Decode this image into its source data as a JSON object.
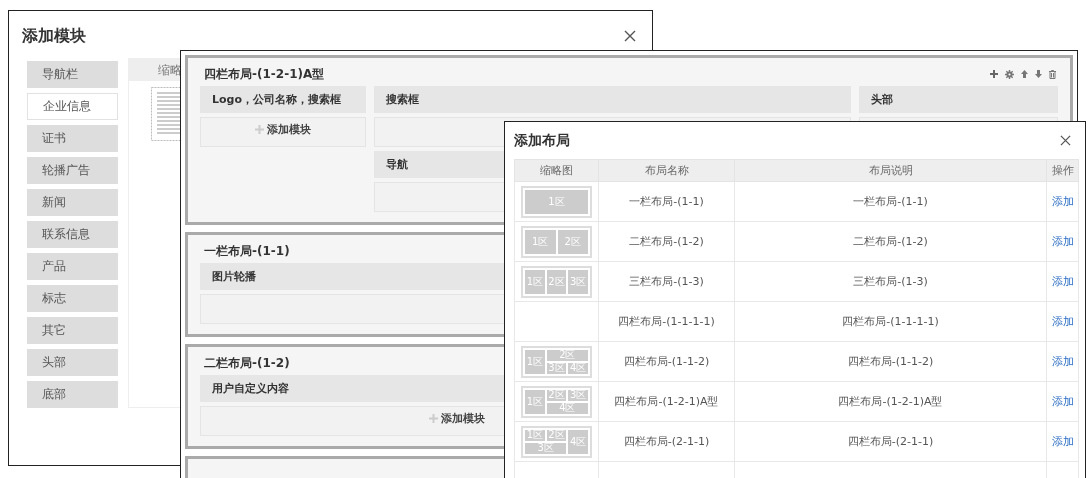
{
  "module_dialog": {
    "title": "添加模块",
    "sidebar": {
      "items": [
        {
          "label": "导航栏",
          "selected": false
        },
        {
          "label": "企业信息",
          "selected": true
        },
        {
          "label": "证书",
          "selected": false
        },
        {
          "label": "轮播广告",
          "selected": false
        },
        {
          "label": "新闻",
          "selected": false
        },
        {
          "label": "联系信息",
          "selected": false
        },
        {
          "label": "产品",
          "selected": false
        },
        {
          "label": "标志",
          "selected": false
        },
        {
          "label": "其它",
          "selected": false
        },
        {
          "label": "头部",
          "selected": false
        },
        {
          "label": "底部",
          "selected": false
        }
      ]
    },
    "preview_header": "缩略"
  },
  "layout_editor": {
    "sections": [
      {
        "title": "四栏布局-(1-2-1)A型",
        "kind": "three-column",
        "columns": [
          [
            {
              "label": "Logo，公司名称，搜索框",
              "add_label": "添加模块"
            }
          ],
          [
            {
              "label": "搜索框"
            },
            {
              "label": "导航"
            }
          ],
          [
            {
              "label": "头部"
            }
          ]
        ]
      },
      {
        "title": "一栏布局-(1-1)",
        "kind": "one-column",
        "columns": [
          [
            {
              "label": "图片轮播"
            }
          ]
        ]
      },
      {
        "title": "二栏布局-(1-2)",
        "kind": "one-column",
        "columns": [
          [
            {
              "label": "用户自定义内容",
              "add_label": "添加模块"
            }
          ]
        ]
      }
    ]
  },
  "layout_dialog": {
    "title": "添加布局",
    "columns": [
      "缩略图",
      "布局名称",
      "布局说明",
      "操作"
    ],
    "rows": [
      {
        "thumbnail": {
          "kind": "single",
          "zones": [
            "1区"
          ]
        },
        "name": "一栏布局-(1-1)",
        "description": "一栏布局-(1-1)",
        "action": "添加"
      },
      {
        "thumbnail": {
          "kind": "halves",
          "zones": [
            "1区",
            "2区"
          ]
        },
        "name": "二栏布局-(1-2)",
        "description": "二栏布局-(1-2)",
        "action": "添加"
      },
      {
        "thumbnail": {
          "kind": "thirds",
          "zones": [
            "1区",
            "2区",
            "3区"
          ]
        },
        "name": "三栏布局-(1-3)",
        "description": "三栏布局-(1-3)",
        "action": "添加"
      },
      {
        "name": "四栏布局-(1-1-1-1)",
        "description": "四栏布局-(1-1-1-1)",
        "action": "添加"
      },
      {
        "thumbnail": {
          "kind": "rightsplit",
          "zones": [
            "1区",
            "2区",
            "3区",
            "4区"
          ]
        },
        "name": "四栏布局-(1-1-2)",
        "description": "四栏布局-(1-1-2)",
        "action": "添加"
      },
      {
        "thumbnail": {
          "kind": "middlesplit",
          "zones": [
            "1区",
            "2区",
            "3区",
            "4区"
          ]
        },
        "name": "四栏布局-(1-2-1)A型",
        "description": "四栏布局-(1-2-1)A型",
        "action": "添加"
      },
      {
        "thumbnail": {
          "kind": "leftgrid",
          "zones": [
            "1区",
            "2区",
            "3区",
            "4区"
          ]
        },
        "name": "四栏布局-(2-1-1)",
        "description": "四栏布局-(2-1-1)",
        "action": "添加"
      }
    ]
  }
}
